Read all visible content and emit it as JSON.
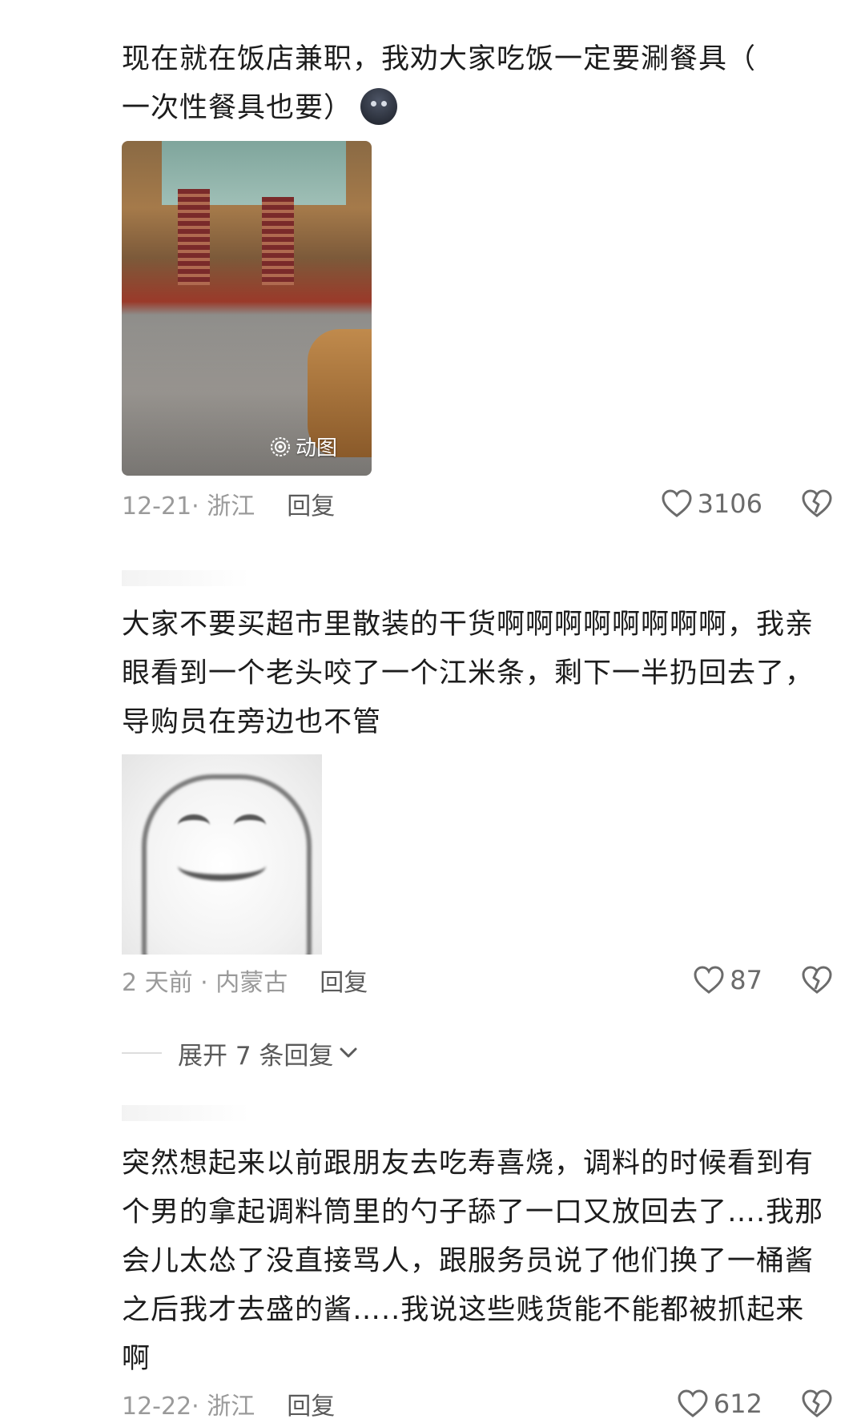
{
  "comments": [
    {
      "text": "现在就在饭店兼职，我劝大家吃饭一定要涮餐具（一次性餐具也要）",
      "line1": "现在就在饭店兼职，我劝大家吃饭一定要涮餐具（",
      "line2": "一次性餐具也要）",
      "image_badge": "动图",
      "date_location": "12-21· 浙江",
      "reply_label": "回复",
      "likes": "3106"
    },
    {
      "line1": "大家不要买超市里散装的干货啊啊啊啊啊啊啊啊，我亲",
      "line2": "眼看到一个老头咬了一个江米条，剩下一半扔回去了，",
      "line3": "导购员在旁边也不管",
      "date_location": "2 天前 · 内蒙古",
      "reply_label": "回复",
      "likes": "87",
      "expand_label": "展开 7 条回复"
    },
    {
      "line1": "突然想起来以前跟朋友去吃寿喜烧，调料的时候看到有",
      "line2": "个男的拿起调料筒里的勺子舔了一口又放回去了….我那",
      "line3": "会儿太怂了没直接骂人，跟服务员说了他们换了一桶酱",
      "line4": "之后我才去盛的酱…..我说这些贱货能不能都被抓起来",
      "line5": "啊",
      "date_location": "12-22· 浙江",
      "reply_label": "回复",
      "likes": "612"
    }
  ],
  "colors": {
    "text": "#1c1c1c",
    "meta": "#9a9a9a",
    "reply": "#5a5a5a"
  },
  "icons": {
    "like": "heart-outline-icon",
    "dislike": "broken-heart-icon",
    "expand": "chevron-down-icon",
    "badge": "live-photo-icon",
    "emoji": "dark-face-emoji"
  }
}
